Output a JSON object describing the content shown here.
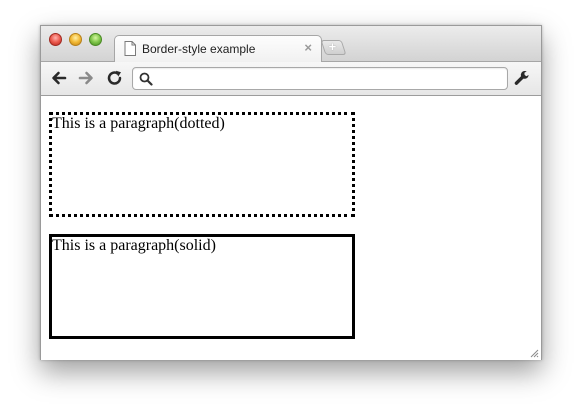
{
  "window": {
    "tab": {
      "title": "Border-style example",
      "close_glyph": "×",
      "icon": "page-icon"
    },
    "new_tab_glyph": "+",
    "toolbar": {
      "back_icon": "back-arrow-icon",
      "forward_icon": "forward-arrow-icon",
      "reload_icon": "reload-icon",
      "omnibox": {
        "value": "",
        "placeholder": "",
        "icon": "search-icon"
      },
      "menu_icon": "wrench-icon"
    }
  },
  "content": {
    "paragraphs": [
      {
        "text": "This is a paragraph(dotted)",
        "border_style": "dotted",
        "border_color": "#000000"
      },
      {
        "text": "This is a paragraph(solid)",
        "border_style": "solid",
        "border_color": "#000000"
      }
    ]
  }
}
